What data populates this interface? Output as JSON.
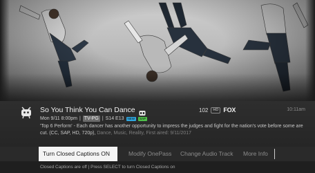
{
  "program": {
    "title": "So You Think You Can Dance",
    "airing": "Mon 9/11 8:00pm",
    "rating": "TV-PG",
    "episode": "S14 E13",
    "badges": {
      "new": "NEW",
      "sap": "SAP"
    },
    "description": "'Top 6 Perform' - Each dancer has another opportunity to impress the judges and fight for the nation's vote before some are cut. (CC, SAP, HD, 720p),",
    "genres": "Dance, Music, Reality, First aired: 9/11/2017"
  },
  "channel": {
    "number": "102",
    "hd_badge": "HD",
    "network": "FOX"
  },
  "clock": "10:11am",
  "actions": {
    "selected": "Turn Closed Captions ON",
    "modify_onepass": "Modify OnePass",
    "change_audio": "Change Audio Track",
    "more_info": "More Info"
  },
  "help_text": "Closed Captions are off | Press SELECT to turn Closed Captions on",
  "icons": {
    "channel_logo": "tivo-icon",
    "cc": "closed-caption-icon"
  },
  "colors": {
    "selected_bg": "#f4f4f4",
    "new_badge": "#2fa7e0",
    "sap_badge": "#4fbf4a"
  }
}
